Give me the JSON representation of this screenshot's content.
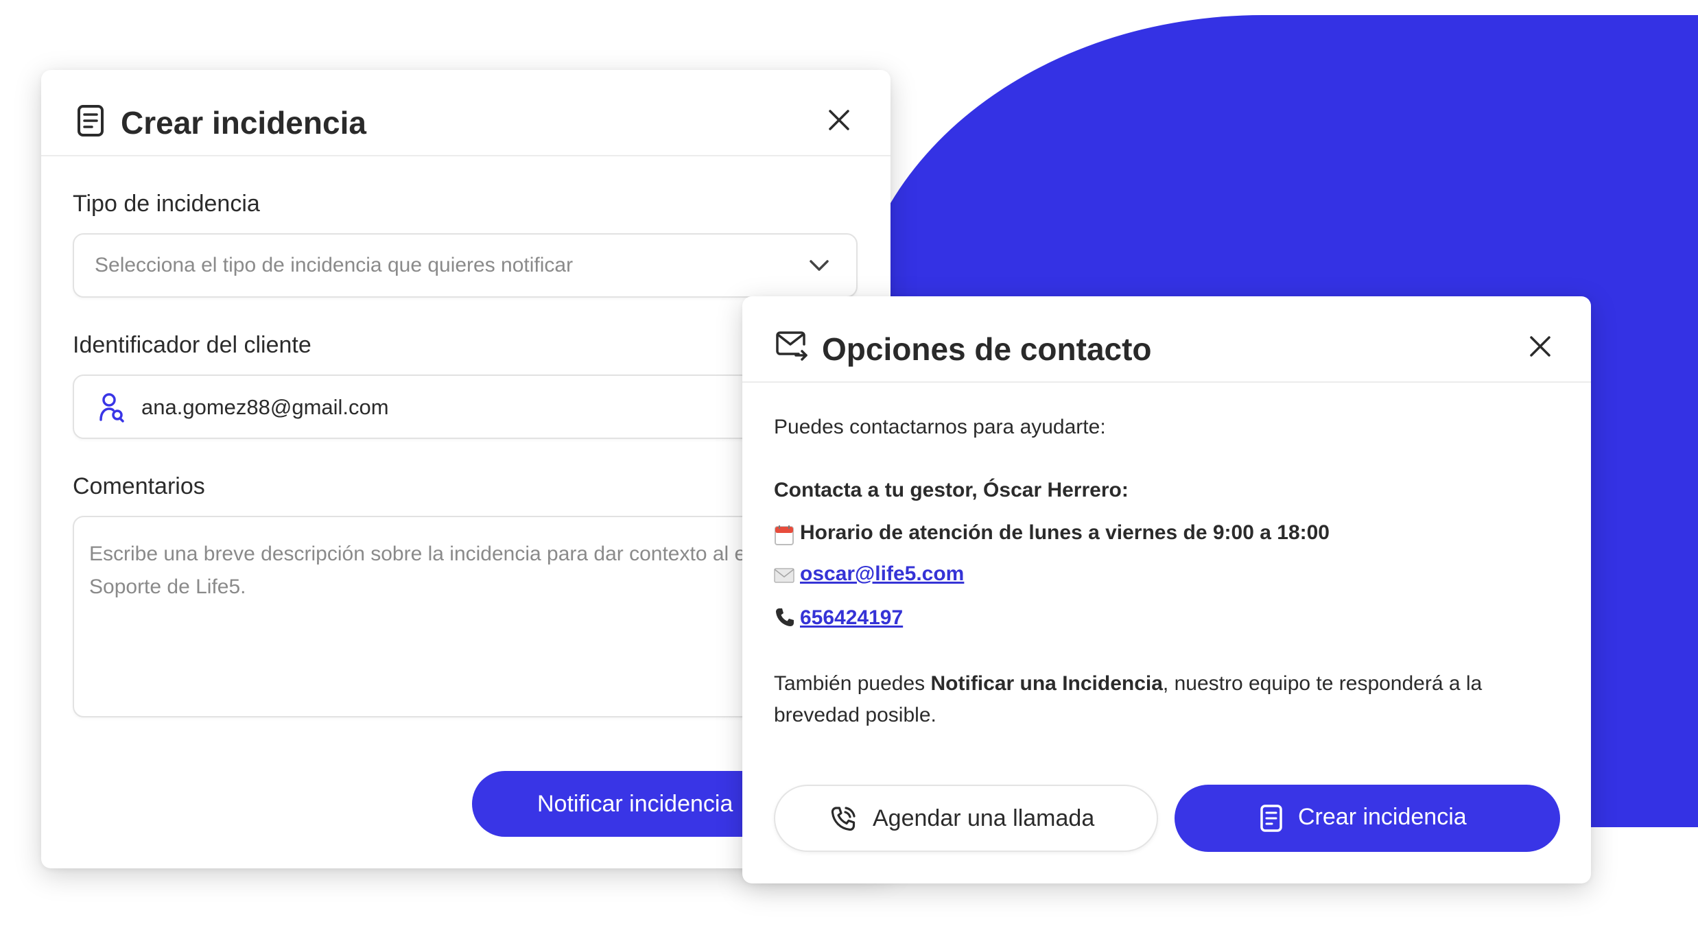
{
  "left_modal": {
    "title": "Crear incidencia",
    "type_label": "Tipo de incidencia",
    "type_placeholder": "Selecciona el tipo de incidencia que quieres notificar",
    "client_label": "Identificador del cliente",
    "client_value": "ana.gomez88@gmail.com",
    "comments_label": "Comentarios",
    "comments_placeholder": "Escribe una breve descripción sobre la incidencia para dar contexto al equipo de Soporte de Life5.",
    "submit_label": "Notificar incidencia"
  },
  "right_modal": {
    "title": "Opciones de contacto",
    "intro": "Puedes contactarnos para ayudarte:",
    "manager_heading": "Contacta a tu gestor, Óscar Herrero:",
    "hours": "Horario de atención de lunes a viernes de 9:00 a 18:00",
    "email": "oscar@life5.com",
    "phone": "656424197",
    "also_prefix": "También puedes ",
    "also_bold": "Notificar una Incidencia",
    "also_suffix": ", nuestro equipo te responderá a la brevedad posible.",
    "schedule_button": "Agendar una llamada",
    "create_button": "Crear incidencia"
  },
  "colors": {
    "accent": "#3935e6",
    "background_shape": "#3432e4"
  },
  "icons": {
    "left_title": "document-icon",
    "close": "close-icon",
    "dropdown": "chevron-down-icon",
    "user": "user-search-icon",
    "right_title": "mail-forward-icon",
    "calendar": "calendar-icon",
    "envelope": "envelope-icon",
    "phone": "phone-icon",
    "phone_call": "phone-call-icon",
    "document": "document-icon"
  }
}
